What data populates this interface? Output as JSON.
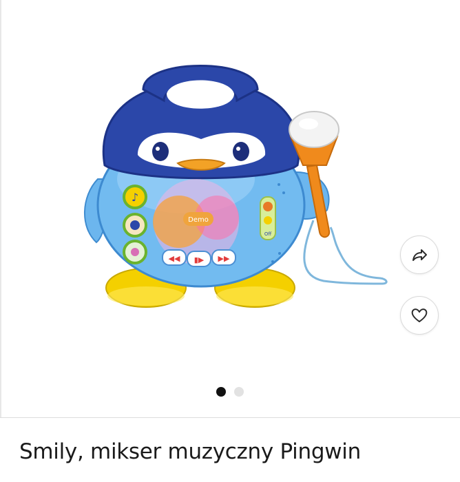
{
  "product": {
    "title": "Smily, mikser muzyczny Pingwin",
    "image": {
      "buttons": [
        "Demo",
        "Off"
      ]
    }
  },
  "actions": {
    "share_icon": "share-icon",
    "favorite_icon": "heart-icon"
  },
  "carousel": {
    "total": 2,
    "active": 1
  },
  "colors": {
    "body_blue": "#6fb8ef",
    "head_navy": "#2a45a8",
    "feet_yellow": "#f5d200",
    "mic_orange": "#f08a1c"
  }
}
